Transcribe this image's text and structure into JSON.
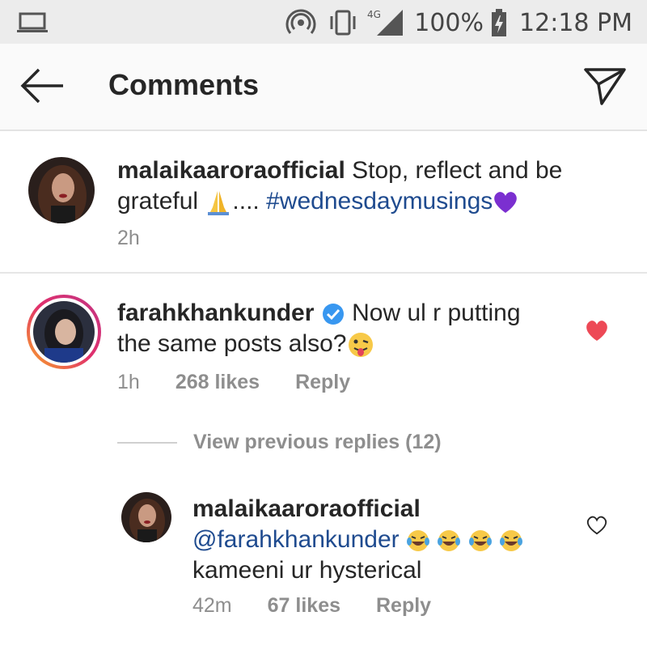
{
  "status_bar": {
    "battery": "100%",
    "network": "4G",
    "time": "12:18 PM"
  },
  "header": {
    "title": "Comments"
  },
  "caption": {
    "username": "malaikaaroraofficial",
    "text_part1": "Stop, reflect and be",
    "text_part2": "grateful",
    "text_part3": "....",
    "hashtag": "#wednesdaymusings",
    "time": "2h"
  },
  "comment": {
    "username": "farahkhankunder",
    "text_part1": "Now ul r putting",
    "text_part2": "the same posts also?",
    "time": "1h",
    "likes": "268 likes",
    "reply_label": "Reply",
    "liked": true
  },
  "view_replies": {
    "label": "View previous replies (12)"
  },
  "reply": {
    "username": "malaikaaroraofficial",
    "mention": "@farahkhankunder",
    "text": "kameeni ur hysterical",
    "time": "42m",
    "likes": "67 likes",
    "reply_label": "Reply",
    "liked": false
  },
  "colors": {
    "heart_liked": "#ed4956",
    "hashtag": "#1f4b8f",
    "verified": "#3897f0",
    "muted": "#8e8e8e"
  }
}
